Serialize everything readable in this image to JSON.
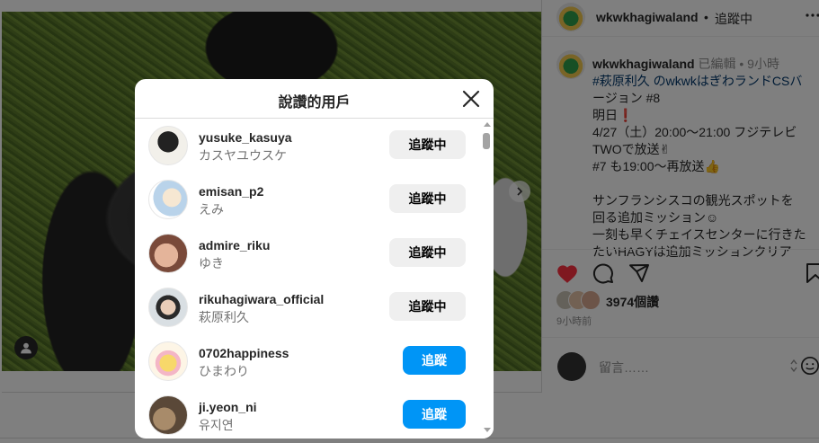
{
  "post": {
    "author": "wkwkhagiwaland",
    "follow_status": "追蹤中",
    "dot": "•",
    "caption": {
      "author": "wkwkhagiwaland",
      "edited": "已編輯",
      "time": "9小時",
      "lines": [
        "#萩原利久 のwkwkはぎわランドCSバ",
        "ージョン #8",
        "明日❗",
        "4/27（土）20:00～21:00 フジテレビ",
        "TWOで放送✌",
        "#7 も19:00〜再放送👍",
        "",
        "サンフランシスコの観光スポットを",
        "回る追加ミッション☺",
        "一刻も早くチェイスセンターに行きた",
        "たいHAGYは追加ミッションクリア"
      ]
    },
    "likes_label": "3974個讚",
    "time_ago": "9小時前",
    "comment_placeholder": "留言……",
    "more": "•••"
  },
  "modal": {
    "title": "說讚的用戶",
    "users": [
      {
        "username": "yusuke_kasuya",
        "fullname": "カスヤユウスケ",
        "button": "追蹤中",
        "state": "following"
      },
      {
        "username": "emisan_p2",
        "fullname": "えみ",
        "button": "追蹤中",
        "state": "following"
      },
      {
        "username": "admire_riku",
        "fullname": "ゆき",
        "button": "追蹤中",
        "state": "following"
      },
      {
        "username": "rikuhagiwara_official",
        "fullname": "萩原利久",
        "button": "追蹤中",
        "state": "following"
      },
      {
        "username": "0702happiness",
        "fullname": "ひまわり",
        "button": "追蹤",
        "state": "follow"
      },
      {
        "username": "ji.yeon_ni",
        "fullname": "유지연",
        "button": "追蹤",
        "state": "follow"
      }
    ]
  },
  "colors": {
    "accent": "#0095f6",
    "following_bg": "#efefef",
    "heart": "#ff3040",
    "hashtag": "#00376b"
  }
}
